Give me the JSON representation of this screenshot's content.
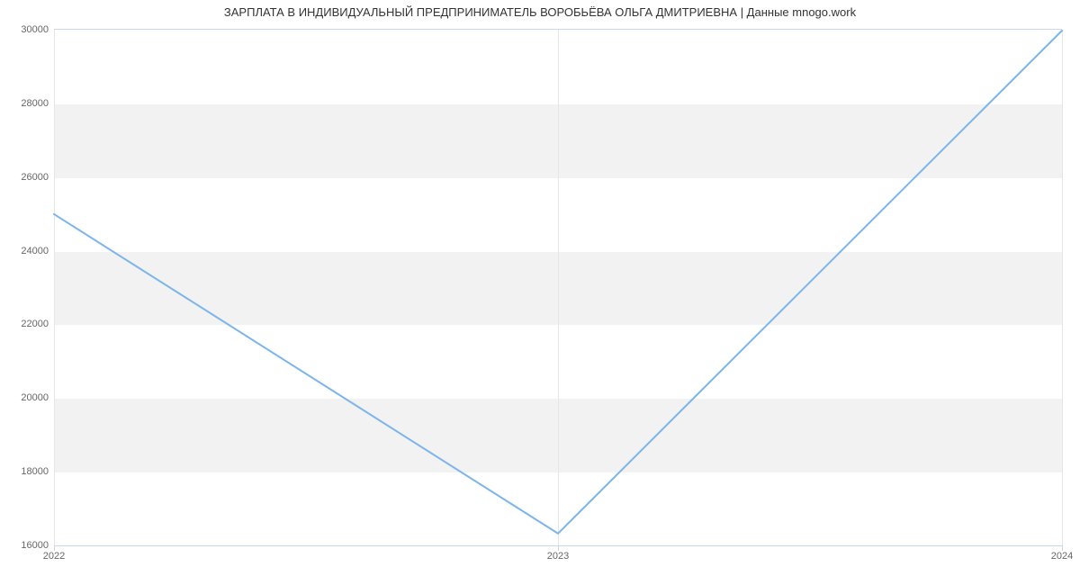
{
  "chart_data": {
    "type": "line",
    "title": "ЗАРПЛАТА В ИНДИВИДУАЛЬНЫЙ ПРЕДПРИНИМАТЕЛЬ ВОРОБЬЁВА ОЛЬГА ДМИТРИЕВНА | Данные mnogo.work",
    "x": [
      "2022",
      "2023",
      "2024"
    ],
    "values": [
      25000,
      16300,
      30000
    ],
    "xlabel": "",
    "ylabel": "",
    "ylim": [
      16000,
      30000
    ],
    "y_ticks": [
      16000,
      18000,
      20000,
      22000,
      24000,
      26000,
      28000,
      30000
    ],
    "line_color": "#7cb5ec",
    "band_color": "#f2f2f2"
  }
}
